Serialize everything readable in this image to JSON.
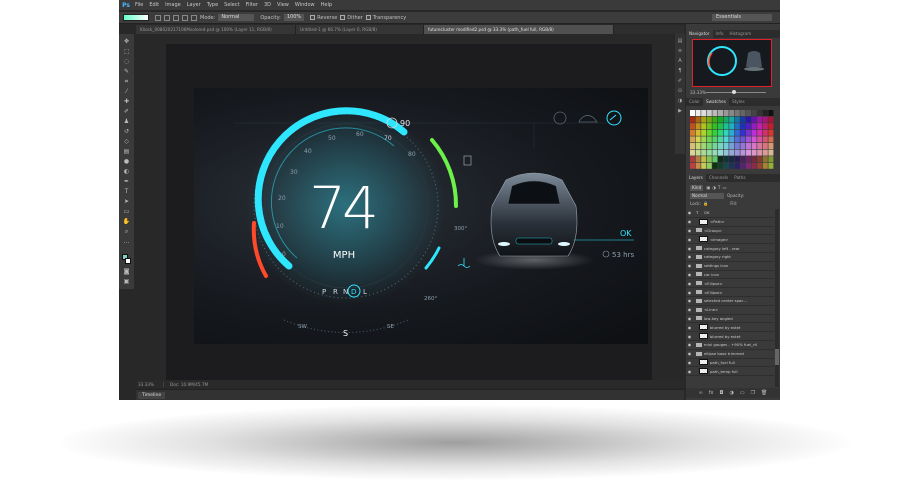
{
  "app": {
    "logo": "Ps"
  },
  "menu": [
    "File",
    "Edit",
    "Image",
    "Layer",
    "Type",
    "Select",
    "Filter",
    "3D",
    "View",
    "Window",
    "Help"
  ],
  "options": {
    "mode_label": "Mode:",
    "mode_value": "Normal",
    "opacity_label": "Opacity:",
    "opacity_value": "100%",
    "reverse": "Reverse",
    "dither": "Dither",
    "transparency": "Transparency",
    "workspace": "Essentials"
  },
  "doc_tabs": [
    "Kliock_008020217106Msolored.psd @ 100% (Layer 11, RGB/8)",
    "Untitled-1 @ 66.7% (Layer 0, RGB/8)",
    "futurecluster modified2.psd @ 33.3% (path_fuel full, RGB/8)"
  ],
  "active_tab": 2,
  "status": {
    "zoom": "33.33%",
    "doc": "Doc: 10.9M/45.7M"
  },
  "timeline": "Timeline",
  "dashboard": {
    "speed": "74",
    "unit": "MPH",
    "gears": [
      "P",
      "R",
      "N",
      "D",
      "L"
    ],
    "active_gear": "D",
    "limit": "90",
    "scale": [
      "0",
      "10",
      "20",
      "30",
      "40",
      "50",
      "60",
      "70",
      "80"
    ],
    "compass": {
      "left": "SW",
      "center": "S",
      "right": "SE"
    },
    "temps": [
      "300°",
      "260°"
    ],
    "status_ok": "OK",
    "range": "53 hrs",
    "colors": {
      "cyan": "#2fe6ff",
      "red": "#ff4a2a",
      "green": "#6cf04a"
    }
  },
  "navigator": {
    "tabs": [
      "Navigator",
      "Info",
      "Histogram"
    ],
    "zoom": "33.33%"
  },
  "swatches_panel": {
    "tabs": [
      "Color",
      "Swatches",
      "Styles"
    ]
  },
  "layers_panel": {
    "tabs": [
      "Layers",
      "Channels",
      "Paths"
    ],
    "kind": "Kind",
    "blend": "Normal",
    "opacity_label": "Opacity:",
    "lock_label": "Lock:",
    "fill_label": "Fill:",
    "rows": [
      {
        "label": "OK",
        "type": "text"
      },
      {
        "label": "<Path>",
        "type": "thumb"
      },
      {
        "label": "<Group>",
        "type": "folder"
      },
      {
        "label": "<Image>",
        "type": "thumb"
      },
      {
        "label": "category left - rear",
        "type": "folder"
      },
      {
        "label": "category right",
        "type": "folder"
      },
      {
        "label": "settings icon",
        "type": "folder"
      },
      {
        "label": "car icon",
        "type": "folder"
      },
      {
        "label": "<Ellipse>",
        "type": "folder"
      },
      {
        "label": "<Ellipse>",
        "type": "folder"
      },
      {
        "label": "selected center spac...",
        "type": "folder"
      },
      {
        "label": "<Line>",
        "type": "folder"
      },
      {
        "label": "low-key angled",
        "type": "folder"
      },
      {
        "label": "blurred by extet",
        "type": "thumb"
      },
      {
        "label": "blurred by extet",
        "type": "thumb"
      },
      {
        "label": "mini gauges - +90% fuel_rtl",
        "type": "folder"
      },
      {
        "label": "ellipse base trimmed",
        "type": "folder"
      },
      {
        "label": "path_fuel full",
        "type": "thumb"
      },
      {
        "label": "path_temp full",
        "type": "thumb"
      }
    ]
  }
}
